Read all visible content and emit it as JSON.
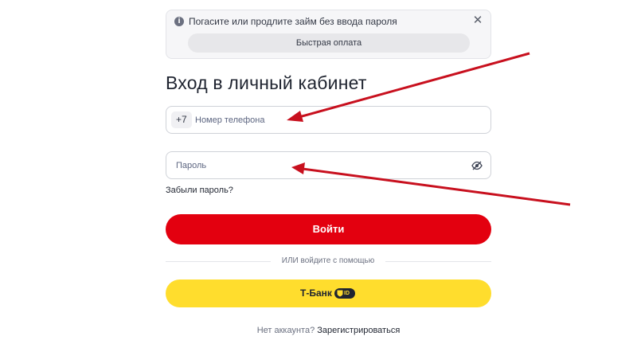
{
  "notice": {
    "info_icon": "i",
    "text": "Погасите или продлите займ без ввода пароля",
    "close_icon": "✕",
    "quick_pay_label": "Быстрая оплата"
  },
  "title": "Вход в личный кабинет",
  "phone": {
    "prefix": "+7",
    "placeholder": "Номер телефона",
    "value": ""
  },
  "password": {
    "placeholder": "Пароль",
    "value": "",
    "toggle_icon": "eye-slash-icon"
  },
  "forgot_password": "Забыли пароль?",
  "login_button": "Войти",
  "divider_text": "ИЛИ войдите с помощью",
  "tbank": {
    "label": "Т-Банк",
    "badge_text": "ID"
  },
  "register": {
    "prompt": "Нет аккаунта?",
    "link": "Зарегистрироваться"
  },
  "colors": {
    "primary_red": "#e3000f",
    "tbank_yellow": "#ffdd2d",
    "annotation_arrow": "#c8101e"
  }
}
